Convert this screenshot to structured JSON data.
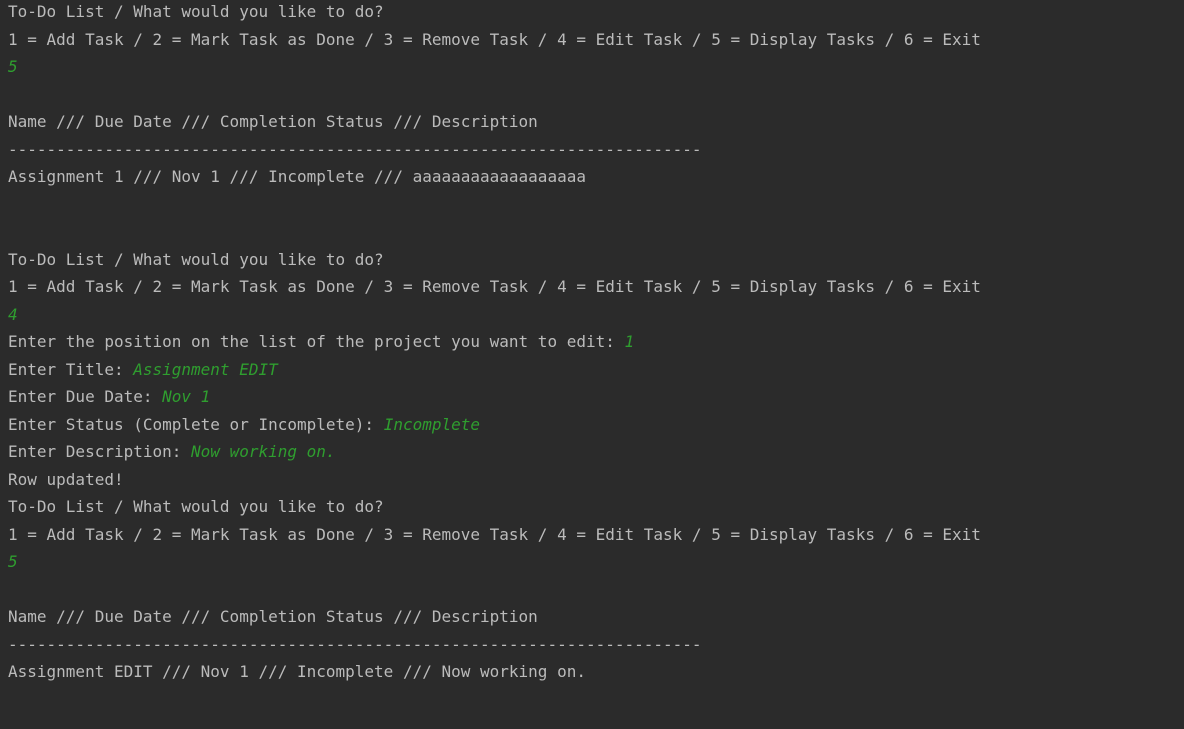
{
  "colors": {
    "background": "#2b2b2b",
    "output_text": "#bbbbbb",
    "user_input": "#2f9e2f"
  },
  "console": {
    "prompt_title": "To-Do List / What would you like to do?",
    "menu_options": "1 = Add Task / 2 = Mark Task as Done / 3 = Remove Task / 4 = Edit Task / 5 = Display Tasks / 6 = Exit",
    "table_header": "Name /// Due Date /// Completion Status /// Description",
    "divider": "------------------------------------------------------------------------",
    "block1": {
      "choice": "5",
      "row": "Assignment 1 /// Nov 1 /// Incomplete /// aaaaaaaaaaaaaaaaaa"
    },
    "block2": {
      "choice": "4",
      "position_prompt": "Enter the position on the list of the project you want to edit: ",
      "position_value": "1",
      "title_prompt": "Enter Title: ",
      "title_value": "Assignment EDIT",
      "due_prompt": "Enter Due Date: ",
      "due_value": "Nov 1",
      "status_prompt": "Enter Status (Complete or Incomplete): ",
      "status_value": "Incomplete",
      "desc_prompt": "Enter Description: ",
      "desc_value": "Now working on.",
      "result": "Row updated!"
    },
    "block3": {
      "choice": "5",
      "row": "Assignment EDIT /// Nov 1 /// Incomplete /// Now working on."
    }
  }
}
